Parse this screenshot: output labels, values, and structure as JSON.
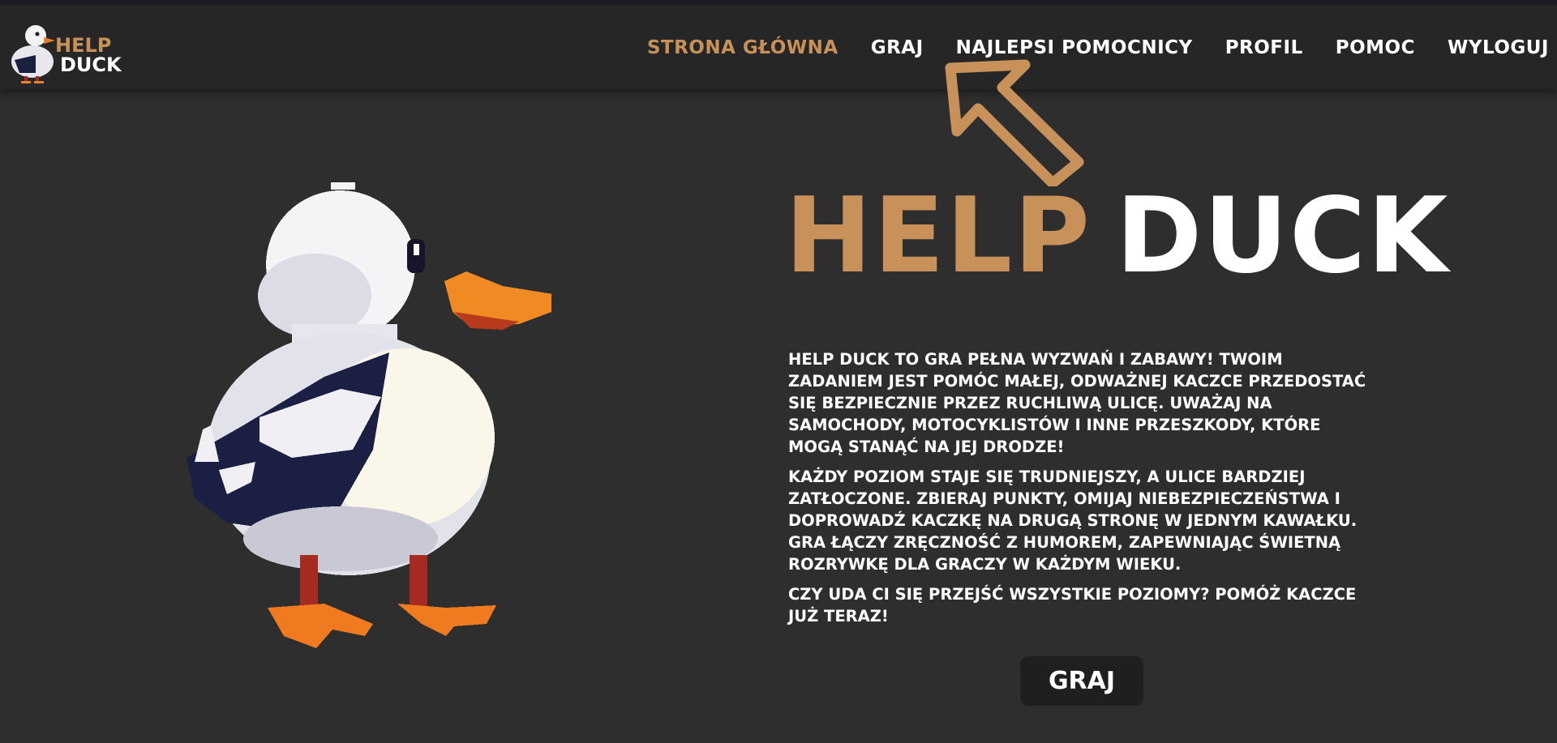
{
  "logo": {
    "help": "HELP",
    "duck": "DUCK"
  },
  "nav": {
    "items": [
      {
        "label": "STRONA GŁÓWNA",
        "active": true
      },
      {
        "label": "GRAJ",
        "active": false
      },
      {
        "label": "NAJLEPSI POMOCNICY",
        "active": false
      },
      {
        "label": "PROFIL",
        "active": false
      },
      {
        "label": "POMOC",
        "active": false
      },
      {
        "label": "WYLOGUJ",
        "active": false
      }
    ]
  },
  "hero": {
    "title_help": "HELP",
    "title_duck": "DUCK",
    "paragraphs": [
      "HELP DUCK TO GRA PEŁNA WYZWAŃ I ZABAWY! TWOIM ZADANIEM JEST POMÓC MAŁEJ, ODWAŻNEJ KACZCE PRZEDOSTAĆ SIĘ BEZPIECZNIE PRZEZ RUCHLIWĄ ULICĘ. UWAŻAJ NA SAMOCHODY, MOTOCYKLISTÓW I INNE PRZESZKODY, KTÓRE MOGĄ STANĄĆ NA JEJ DRODZE!",
      "KAŻDY POZIOM STAJE SIĘ TRUDNIEJSZY, A ULICE BARDZIEJ ZATŁOCZONE. ZBIERAJ PUNKTY, OMIJAJ NIEBEZPIECZEŃSTWA I DOPROWADŹ KACZKĘ NA DRUGĄ STRONĘ W JEDNYM KAWAŁKU. GRA ŁĄCZY ZRĘCZNOŚĆ Z HUMOREM, ZAPEWNIAJĄC ŚWIETNĄ ROZRYWKĘ DLA GRACZY W KAŻDYM WIEKU.",
      "CZY UDA CI SIĘ PRZEJŚĆ WSZYSTKIE POZIOMY? POMÓŻ KACZCE JUŻ TERAZ!"
    ],
    "play_button": "GRAJ"
  },
  "icons": {
    "logo": "duck-logo-icon",
    "arrow": "pointer-arrow-icon",
    "duck": "pixel-duck-illustration"
  },
  "colors": {
    "accent": "#c8915a",
    "background": "#2e2e2e",
    "header": "#262626",
    "button": "#1f1f1f"
  }
}
